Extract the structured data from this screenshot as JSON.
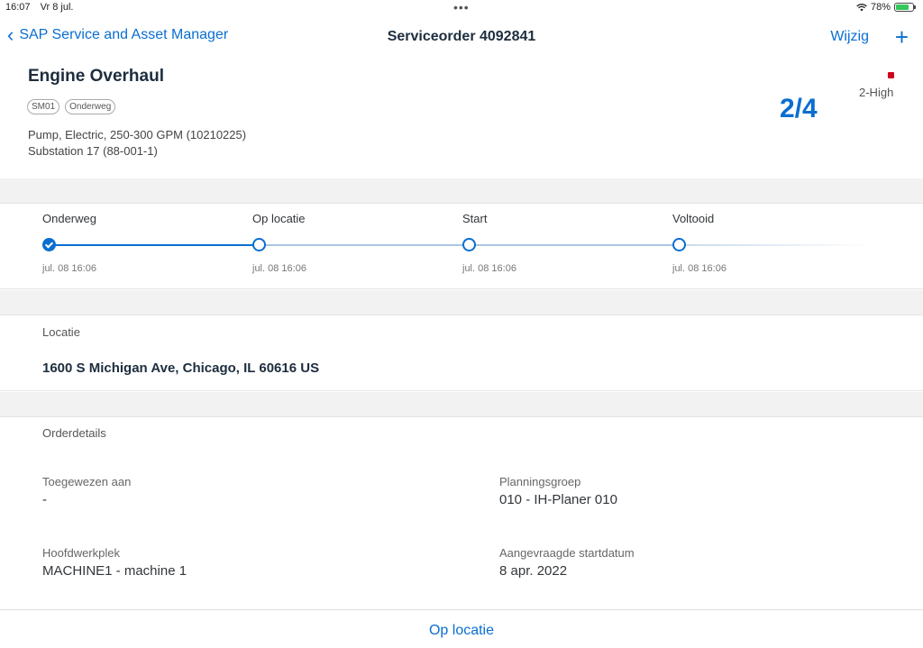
{
  "status_bar": {
    "time": "16:07",
    "date": "Vr 8 jul.",
    "dots": "•••",
    "battery": "78%",
    "battery_level": 0.78
  },
  "nav": {
    "back_label": "SAP Service and Asset Manager",
    "title": "Serviceorder 4092841",
    "edit_label": "Wijzig",
    "add_glyph": "+"
  },
  "header": {
    "title": "Engine Overhaul",
    "tags": [
      "SM01",
      "Onderweg"
    ],
    "line1": "Pump, Electric, 250-300 GPM (10210225)",
    "line2": "Substation 17 (88-001-1)",
    "counter": "2/4",
    "priority": "2-High",
    "priority_color": "#d0021b"
  },
  "timeline": {
    "steps": [
      {
        "label": "Onderweg",
        "date": "jul. 08 16:06",
        "done": true
      },
      {
        "label": "Op locatie",
        "date": "jul. 08 16:06",
        "done": false
      },
      {
        "label": "Start",
        "date": "jul. 08 16:06",
        "done": false
      },
      {
        "label": "Voltooid",
        "date": "jul. 08 16:06",
        "done": false
      }
    ]
  },
  "location": {
    "label": "Locatie",
    "value": "1600 S Michigan Ave, Chicago, IL 60616 US"
  },
  "details": {
    "label": "Orderdetails",
    "assigned_label": "Toegewezen aan",
    "assigned_value": "-",
    "planning_label": "Planningsgroep",
    "planning_value": "010 - IH-Planer 010",
    "workcenter_label": "Hoofdwerkplek",
    "workcenter_value": "MACHINE1 - machine 1",
    "startdate_label": "Aangevraagde startdatum",
    "startdate_value": "8 apr. 2022"
  },
  "bottom": {
    "action_label": "Op locatie"
  },
  "colors": {
    "accent": "#0a6ed1",
    "text": "#32363a"
  }
}
